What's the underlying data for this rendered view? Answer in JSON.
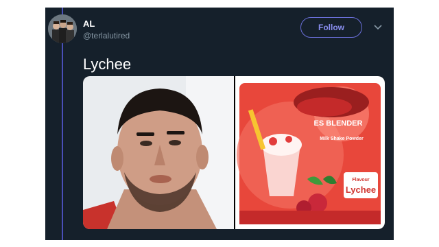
{
  "tweet": {
    "author_name": "AL",
    "author_handle": "@terlalutired",
    "follow_label": "Follow",
    "text": "Lychee"
  },
  "media": {
    "right_image": {
      "brand_text": "ES BLENDER",
      "product_text": "Milk Shake Powder",
      "flavour_label": "Flavour",
      "flavour_name": "Lychee"
    }
  },
  "icons": {
    "more": "chevron-down-icon"
  },
  "colors": {
    "background": "#15202b",
    "accent": "#6a6fd9",
    "muted_text": "#8899a6"
  }
}
